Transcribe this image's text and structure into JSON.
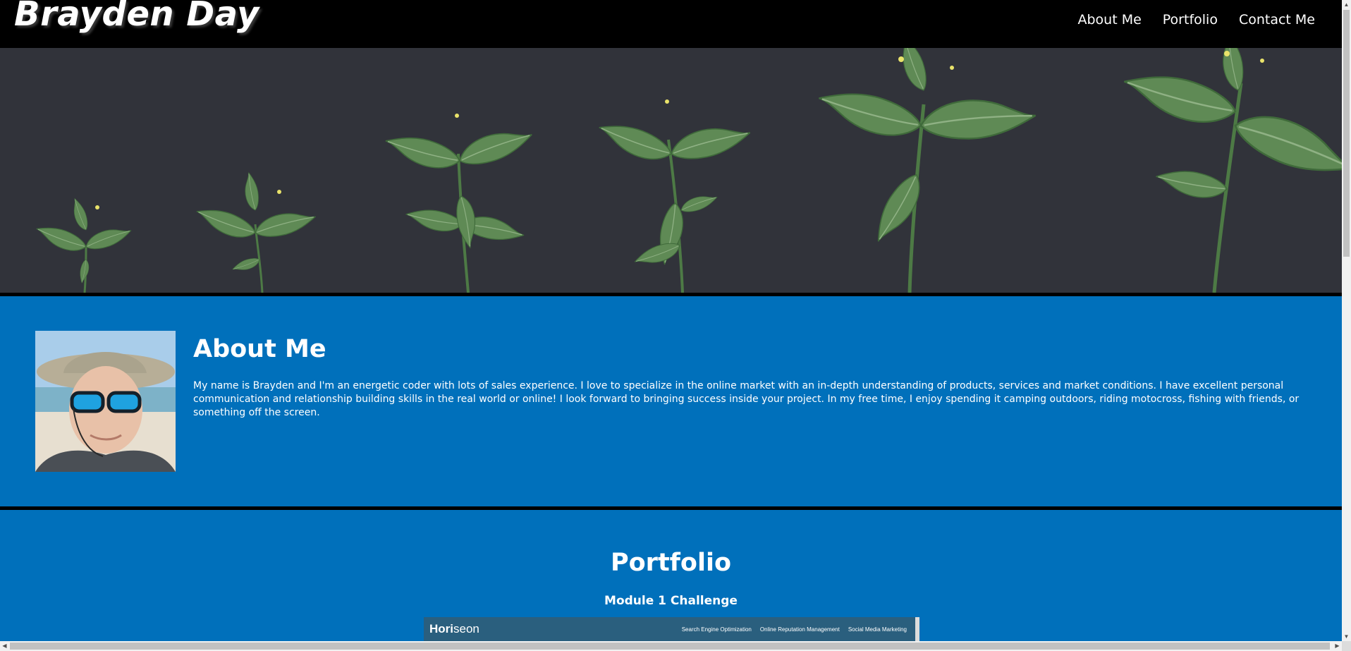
{
  "header": {
    "site_title": "Brayden Day",
    "nav": [
      "About Me",
      "Portfolio",
      "Contact Me"
    ]
  },
  "about": {
    "title": "About Me",
    "text": "My name is Brayden and I'm an energetic coder with lots of sales experience. I love to specialize in the online market with an in-depth understanding of products, services and market conditions. I have excellent personal communication and relationship building skills in the real world or online! I look forward to bringing success inside your project. In my free time, I enjoy spending it camping outdoors, riding motocross, fishing with friends, or something off the screen."
  },
  "portfolio": {
    "title": "Portfolio",
    "project_title": "Module 1 Challenge",
    "preview": {
      "brand_bold": "Hori",
      "brand_light": "seon",
      "links": [
        "Search Engine Optimization",
        "Online Reputation Management",
        "Social Media Marketing"
      ]
    }
  },
  "colors": {
    "header_bg": "#000000",
    "hero_bg": "#31333a",
    "section_bg": "#0070bb",
    "leaf": "#5f8a55",
    "preview_bg": "#2a5f7e"
  }
}
